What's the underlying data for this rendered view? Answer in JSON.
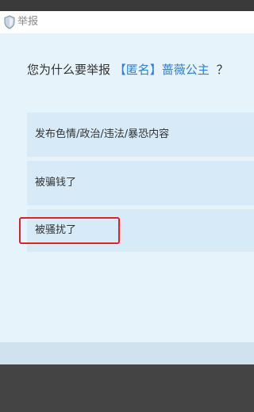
{
  "window": {
    "title": "举报"
  },
  "question": {
    "prefix": "您为什么要举报",
    "target_name": "【匿名】蔷薇公主",
    "suffix": "？"
  },
  "options": [
    {
      "label": "发布色情/政治/违法/暴恐内容"
    },
    {
      "label": "被骗钱了"
    },
    {
      "label": "被骚扰了"
    }
  ],
  "colors": {
    "name_link": "#2f7fd4",
    "highlight_border": "#e02020",
    "option_bg": "#d6ebf7",
    "window_bg": "#e6f3fb"
  }
}
